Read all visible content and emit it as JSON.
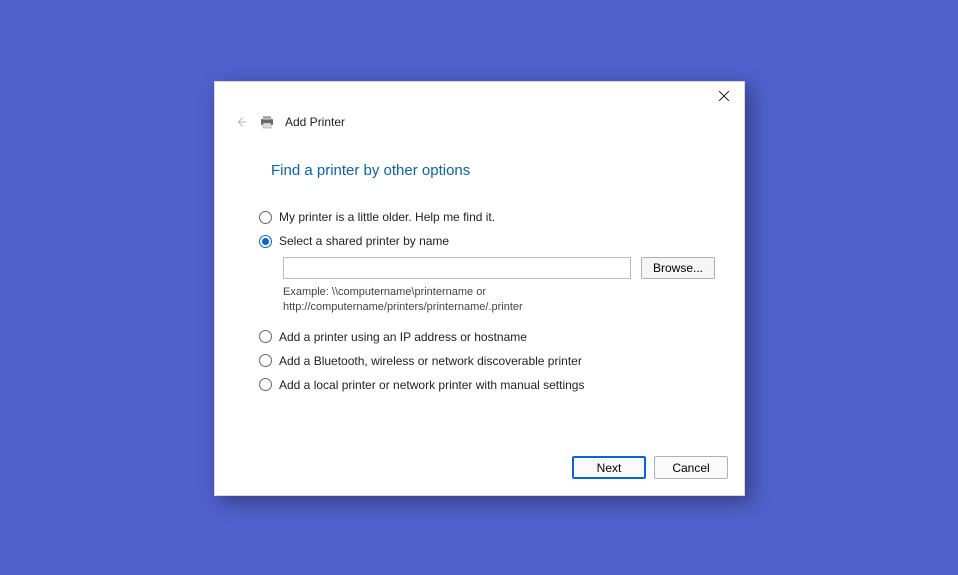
{
  "dialog": {
    "window_title": "Add Printer",
    "page_heading": "Find a printer by other options",
    "options": {
      "opt1": "My printer is a little older. Help me find it.",
      "opt2": "Select a shared printer by name",
      "opt3": "Add a printer using an IP address or hostname",
      "opt4": "Add a Bluetooth, wireless or network discoverable printer",
      "opt5": "Add a local printer or network printer with manual settings"
    },
    "shared_printer": {
      "path_value": "",
      "browse_label": "Browse...",
      "example_text": "Example: \\\\computername\\printername or http://computername/printers/printername/.printer"
    },
    "footer": {
      "next_label": "Next",
      "cancel_label": "Cancel"
    }
  }
}
